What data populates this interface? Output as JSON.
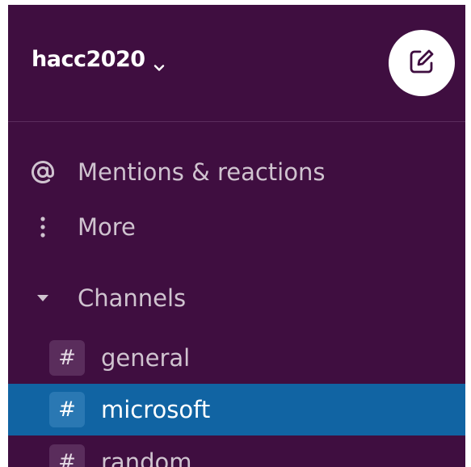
{
  "workspace": {
    "name": "hacc2020",
    "menu_icon": "chevron-down-icon",
    "compose_icon": "compose-icon"
  },
  "nav": {
    "mentions": {
      "icon": "at-icon",
      "label": "Mentions & reactions"
    },
    "more": {
      "icon": "more-vertical-icon",
      "label": "More"
    }
  },
  "channels_section": {
    "icon": "caret-down-icon",
    "label": "Channels"
  },
  "channels": [
    {
      "prefix": "#",
      "name": "general",
      "active": false
    },
    {
      "prefix": "#",
      "name": "microsoft",
      "active": true
    },
    {
      "prefix": "#",
      "name": "random",
      "active": false
    }
  ],
  "colors": {
    "sidebar_bg": "#3f0e40",
    "active_bg": "#1164a3",
    "text": "#cfc3cf"
  }
}
